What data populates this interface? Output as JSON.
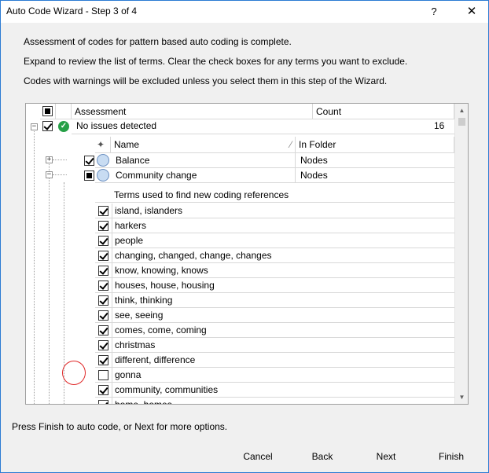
{
  "window": {
    "title": "Auto Code Wizard - Step 3 of 4",
    "help_glyph": "?",
    "close_glyph": "✕"
  },
  "intro": {
    "line1": "Assessment of codes for pattern based auto coding is complete.",
    "line2": "Expand to review the list of terms. Clear the check boxes for any terms you want to exclude.",
    "line3": "Codes with warnings will be excluded unless you select them in this step of the Wizard."
  },
  "grid": {
    "columns": {
      "assessment": "Assessment",
      "count": "Count"
    },
    "assessment_row": {
      "status": "No issues detected",
      "count": "16",
      "checked": true,
      "status_icon": "check-circle-icon"
    },
    "codes": {
      "columns": {
        "name": "Name",
        "in_folder": "In Folder"
      },
      "rows": [
        {
          "name": "Balance",
          "folder": "Nodes",
          "check": "checked",
          "expanded": false
        },
        {
          "name": "Community change",
          "folder": "Nodes",
          "check": "partial",
          "expanded": true
        }
      ]
    },
    "terms": {
      "header": "Terms used to find new coding references",
      "items": [
        {
          "text": "island, islanders",
          "checked": true
        },
        {
          "text": "harkers",
          "checked": true
        },
        {
          "text": "people",
          "checked": true
        },
        {
          "text": "changing, changed, change, changes",
          "checked": true
        },
        {
          "text": "know, knowing, knows",
          "checked": true
        },
        {
          "text": "houses, house, housing",
          "checked": true
        },
        {
          "text": "think, thinking",
          "checked": true
        },
        {
          "text": "see, seeing",
          "checked": true
        },
        {
          "text": "comes, come, coming",
          "checked": true
        },
        {
          "text": "christmas",
          "checked": true
        },
        {
          "text": "different, difference",
          "checked": true
        },
        {
          "text": "gonna",
          "checked": false
        },
        {
          "text": "community, communities",
          "checked": true
        },
        {
          "text": "home, homes",
          "checked": true
        }
      ]
    },
    "scroll_up": "▲",
    "scroll_down": "▼"
  },
  "footer": {
    "hint": "Press Finish to auto code, or Next for more options.",
    "buttons": {
      "cancel": "Cancel",
      "back": "Back",
      "next": "Next",
      "finish": "Finish"
    }
  },
  "colors": {
    "window_border": "#2b7bd3",
    "ok_icon": "#26a047",
    "highlight_ring": "#e02828"
  }
}
